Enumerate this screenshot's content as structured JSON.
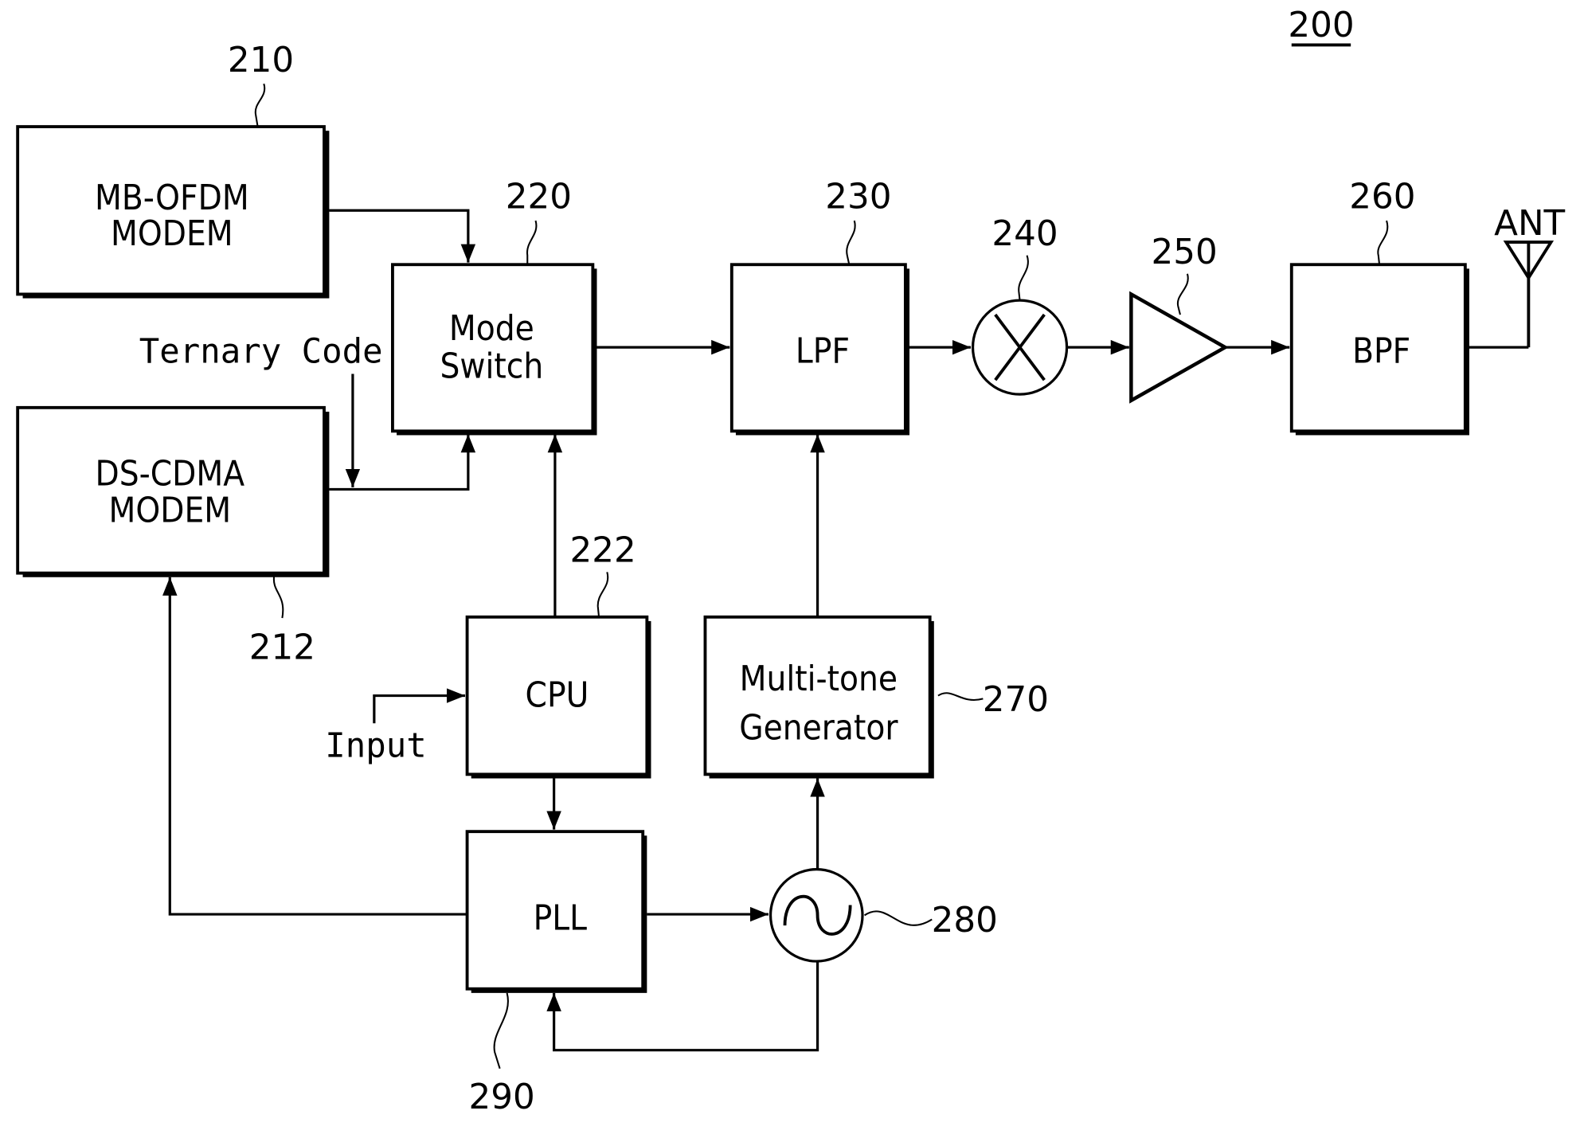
{
  "figure": {
    "reference": "200",
    "blocks": {
      "mb_ofdm": {
        "line1": "MB-OFDM",
        "line2": "MODEM",
        "ref": "210"
      },
      "ds_cdma": {
        "line1": "DS-CDMA",
        "line2": "MODEM",
        "ref": "212"
      },
      "mode_switch": {
        "line1": "Mode",
        "line2": "Switch",
        "ref": "220"
      },
      "cpu": {
        "label": "CPU",
        "ref": "222"
      },
      "lpf": {
        "label": "LPF",
        "ref": "230"
      },
      "mixer": {
        "ref": "240"
      },
      "amplifier": {
        "ref": "250"
      },
      "bpf": {
        "label": "BPF",
        "ref": "260"
      },
      "multitone": {
        "line1": "Multi-tone",
        "line2": "Generator",
        "ref": "270"
      },
      "oscillator": {
        "ref": "280"
      },
      "pll": {
        "label": "PLL",
        "ref": "290"
      }
    },
    "signals": {
      "ternary_code": "Ternary Code",
      "input": "Input",
      "antenna": "ANT"
    }
  }
}
